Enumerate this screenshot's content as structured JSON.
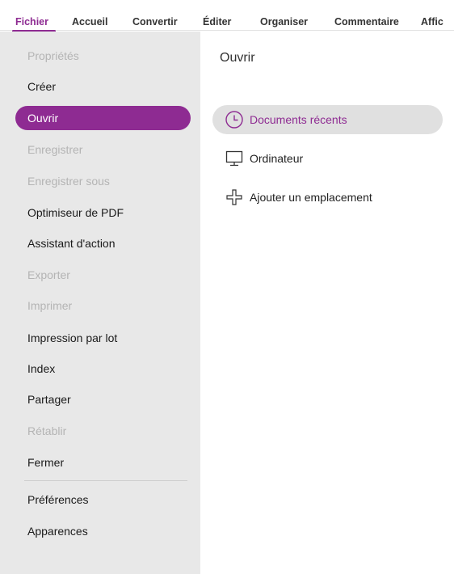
{
  "ribbon": {
    "tabs": [
      {
        "label": "Fichier",
        "active": true
      },
      {
        "label": "Accueil"
      },
      {
        "label": "Convertir"
      },
      {
        "label": "Éditer"
      },
      {
        "label": "Organiser"
      },
      {
        "label": "Commentaire"
      },
      {
        "label": "Affic"
      }
    ]
  },
  "sidebar": {
    "items": [
      {
        "label": "Propriétés",
        "state": "disabled"
      },
      {
        "label": "Créer"
      },
      {
        "label": "Ouvrir",
        "state": "active"
      },
      {
        "label": "Enregistrer",
        "state": "disabled"
      },
      {
        "label": "Enregistrer sous",
        "state": "disabled"
      },
      {
        "label": "Optimiseur de PDF"
      },
      {
        "label": "Assistant d'action"
      },
      {
        "label": "Exporter",
        "state": "disabled"
      },
      {
        "label": "Imprimer",
        "state": "disabled"
      },
      {
        "label": "Impression par lot"
      },
      {
        "label": "Index"
      },
      {
        "label": "Partager"
      },
      {
        "label": "Rétablir",
        "state": "disabled"
      },
      {
        "label": "Fermer"
      },
      {
        "label": "Préférences"
      },
      {
        "label": "Apparences"
      }
    ]
  },
  "main": {
    "title": "Ouvrir",
    "options": [
      {
        "label": "Documents récents",
        "icon": "clock-icon",
        "selected": true
      },
      {
        "label": "Ordinateur",
        "icon": "monitor-icon"
      },
      {
        "label": "Ajouter un emplacement",
        "icon": "plus-icon"
      }
    ]
  },
  "colors": {
    "accent": "#8e2b92",
    "sidebar_bg": "#e8e8e8",
    "disabled_text": "#b4b4b4",
    "selected_option_bg": "#e0e0e0"
  }
}
